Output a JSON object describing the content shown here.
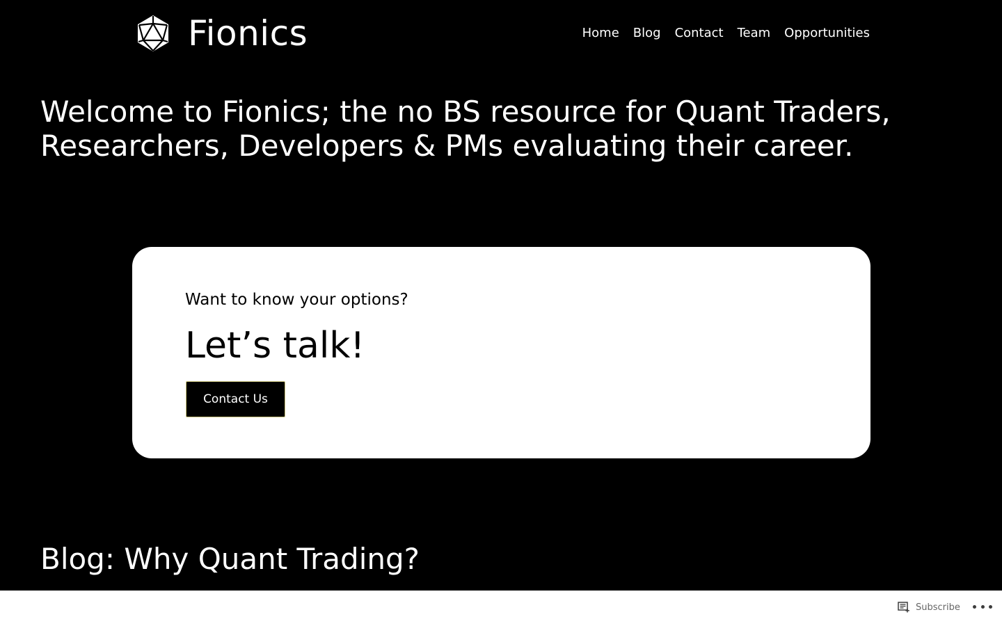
{
  "site": {
    "name": "Fionics"
  },
  "nav": {
    "items": [
      {
        "label": "Home"
      },
      {
        "label": "Blog"
      },
      {
        "label": "Contact"
      },
      {
        "label": "Team"
      },
      {
        "label": "Opportunities"
      }
    ]
  },
  "hero": {
    "heading": "Welcome to Fionics; the no BS resource for Quant Traders, Researchers, Developers & PMs evaluating their career."
  },
  "cta": {
    "kicker": "Want to know your options?",
    "title": "Let’s talk!",
    "button_label": "Contact Us"
  },
  "blog": {
    "heading": "Blog: Why Quant Trading?"
  },
  "footer_bar": {
    "subscribe_label": "Subscribe",
    "subscribe_icon": "reader-icon",
    "more_icon": "ellipsis-icon"
  },
  "colors": {
    "background": "#000000",
    "card": "#ffffff",
    "button": "#000000"
  }
}
